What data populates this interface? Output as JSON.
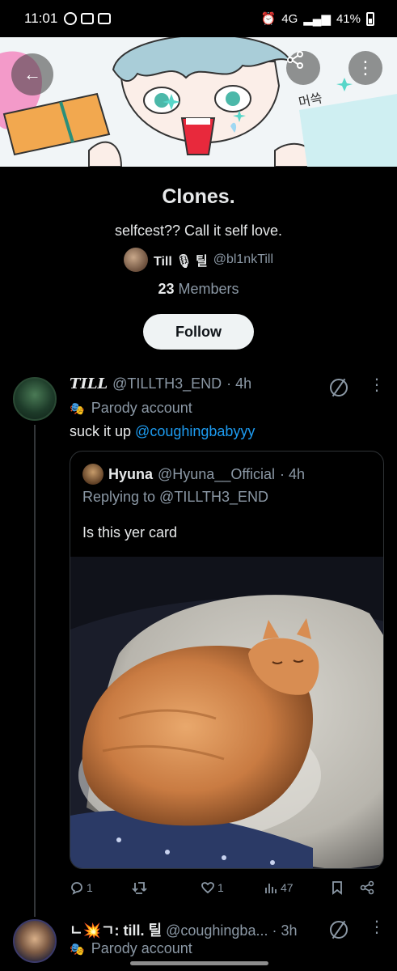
{
  "status_bar": {
    "time": "11:01",
    "network": "4G",
    "battery": "41%"
  },
  "header": {
    "back_icon": "arrow-left-icon",
    "share_icon": "share-icon",
    "more_icon": "more-vertical-icon",
    "banner_text": "머쓱"
  },
  "community": {
    "title": "Clones.",
    "description": "selfcest?? Call it self love.",
    "owner_name": "Till 🎙 틸",
    "owner_handle": "@bl1nkTill",
    "members_count": "23",
    "members_label": "Members",
    "follow_label": "Follow"
  },
  "post": {
    "display_name": "TILL",
    "handle": "@TILLTH3_END",
    "time": "· 4h",
    "parody_label": "Parody account",
    "text_prefix": "suck it up ",
    "text_mention": "@coughingbabyyy",
    "quote": {
      "name": "Hyuna",
      "handle": "@Hyuna__Official",
      "time": "· 4h",
      "replying_to": "Replying to @TILLTH3_END",
      "text": "Is this yer card"
    },
    "stats": {
      "replies": "1",
      "reposts": "",
      "likes": "1",
      "views": "47"
    }
  },
  "post2": {
    "display_name": "ㄴ💥ㄱ: till. 틸",
    "handle": "@coughingba...",
    "time": "· 3h",
    "parody_label": "Parody account"
  }
}
